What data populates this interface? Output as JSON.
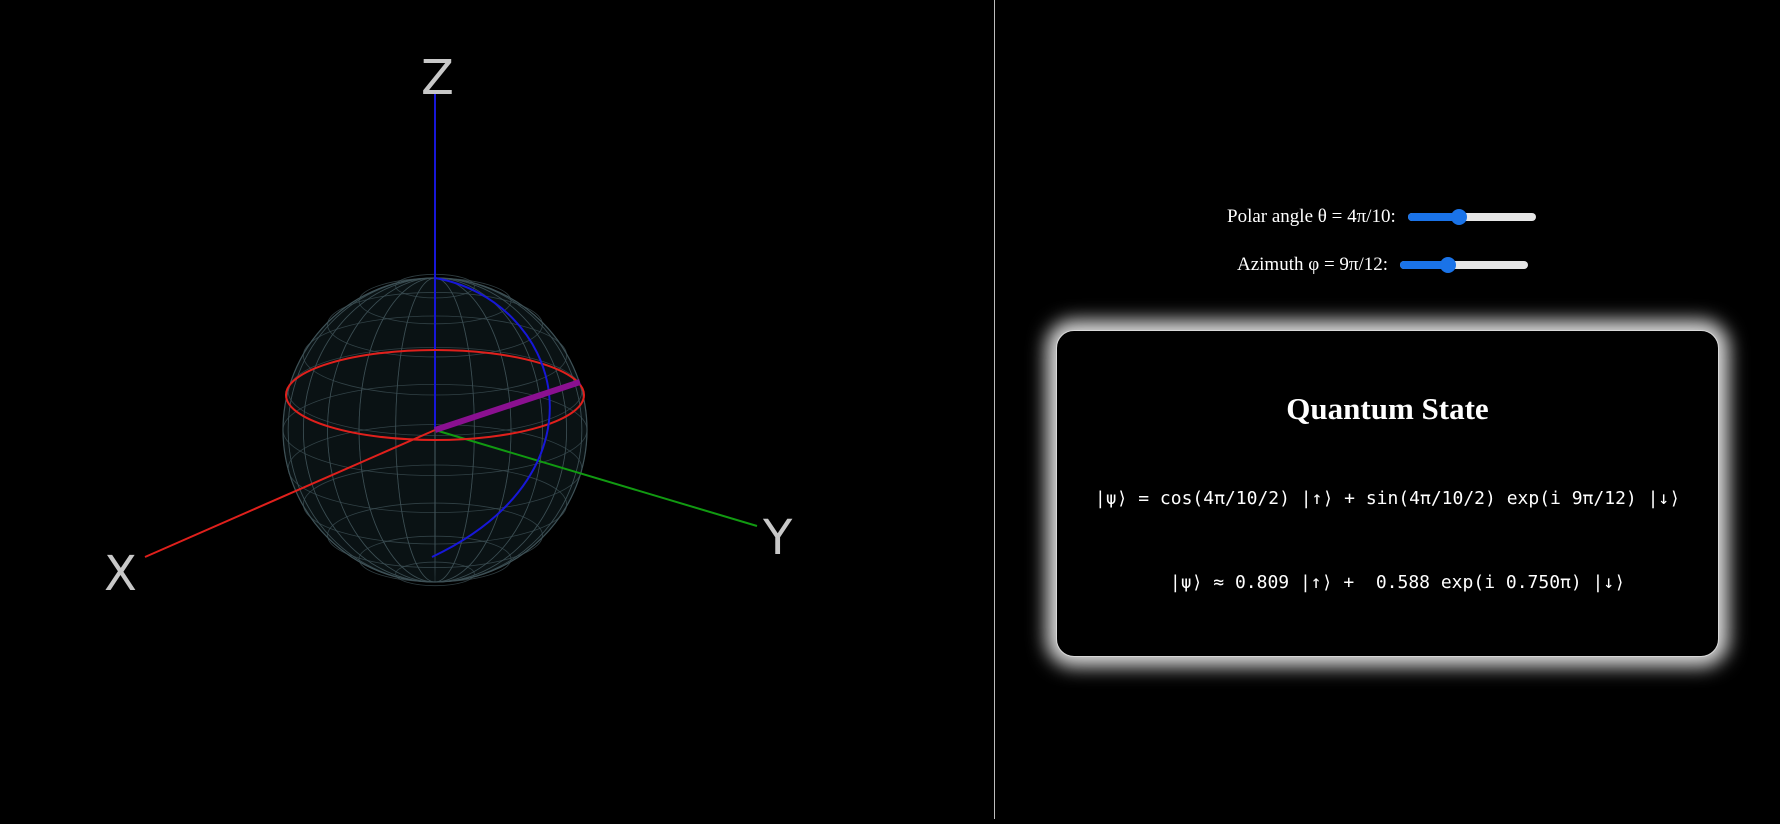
{
  "bloch_sphere": {
    "axis_labels": {
      "x": "X",
      "y": "Y",
      "z": "Z"
    },
    "colors": {
      "x_axis": "#e0201c",
      "y_axis": "#119a11",
      "z_axis": "#1717d8",
      "equator": "#e0201c",
      "meridian": "#1717d8",
      "state_vector": "#8a1090",
      "wireframe": "#3f5257"
    }
  },
  "controls": {
    "polar": {
      "label": "Polar angle θ = 4π/10:",
      "value": 0.4
    },
    "azimuth": {
      "label": "Azimuth φ = 9π/12:",
      "value": 0.375
    }
  },
  "state_card": {
    "title": "Quantum State",
    "formula_exact": "|ψ⟩ = cos(4π/10/2) |↑⟩ + sin(4π/10/2) exp(i 9π/12) |↓⟩",
    "formula_approx": "|ψ⟩ ≈ 0.809 |↑⟩ +  0.588 exp(i 0.750π) |↓⟩"
  }
}
